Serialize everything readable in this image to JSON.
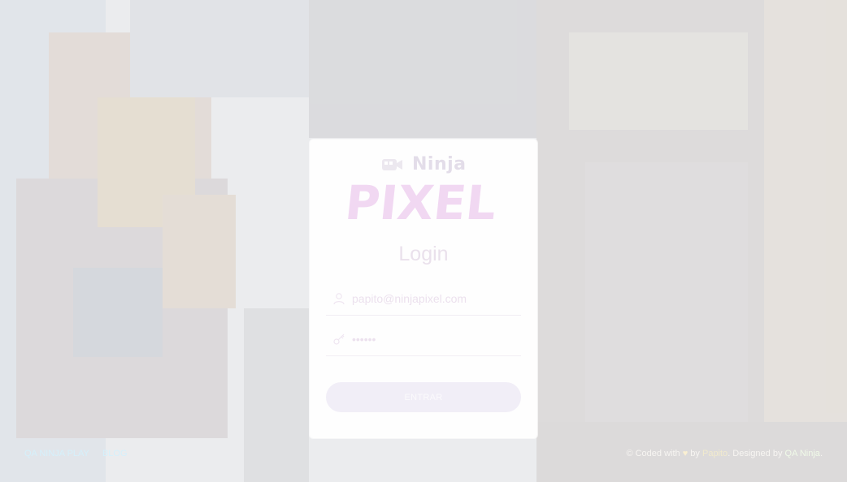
{
  "login": {
    "logo_ninja": "Ninja",
    "logo_pixel": "PIXEL",
    "title": "Login",
    "email_value": "papito@ninjapixel.com",
    "password_value": "••••••",
    "submit_label": "ENTRAR"
  },
  "footer": {
    "links": [
      "QA NINJA PLAY",
      "BLOG"
    ],
    "copyright_prefix": "© Coded with",
    "by": "by",
    "author": "Papito",
    "designed_by": ". Designed by",
    "designer": "QA Ninja",
    "suffix": "."
  },
  "colors": {
    "accent": "#f1eef7",
    "logo_pixel": "#f1d8f2",
    "link": "#d5f0fb"
  },
  "icons": [
    "camera-icon",
    "user-icon",
    "key-icon",
    "heart-icon"
  ]
}
